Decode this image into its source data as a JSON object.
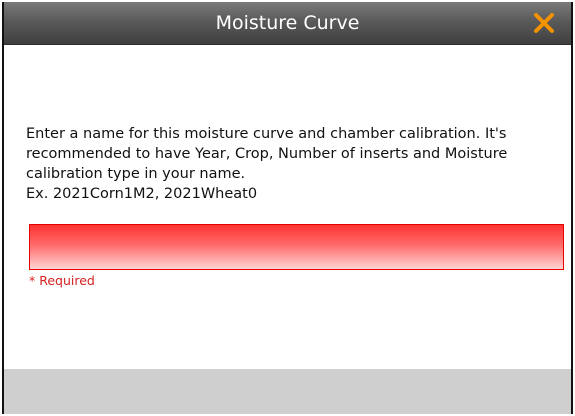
{
  "dialog": {
    "title": "Moisture Curve",
    "close_icon": "close-x-icon",
    "accent_color": "#f39200",
    "description_line1": "Enter a name for this moisture curve and chamber calibration. It's recommended to have Year, Crop, Number of inserts and Moisture calibration type in your name.",
    "description_line2": "Ex. 2021Corn1M2, 2021Wheat0",
    "name_input": {
      "value": "",
      "placeholder": "",
      "state": "error"
    },
    "required_text": "* Required",
    "error_color": "#d42020"
  }
}
